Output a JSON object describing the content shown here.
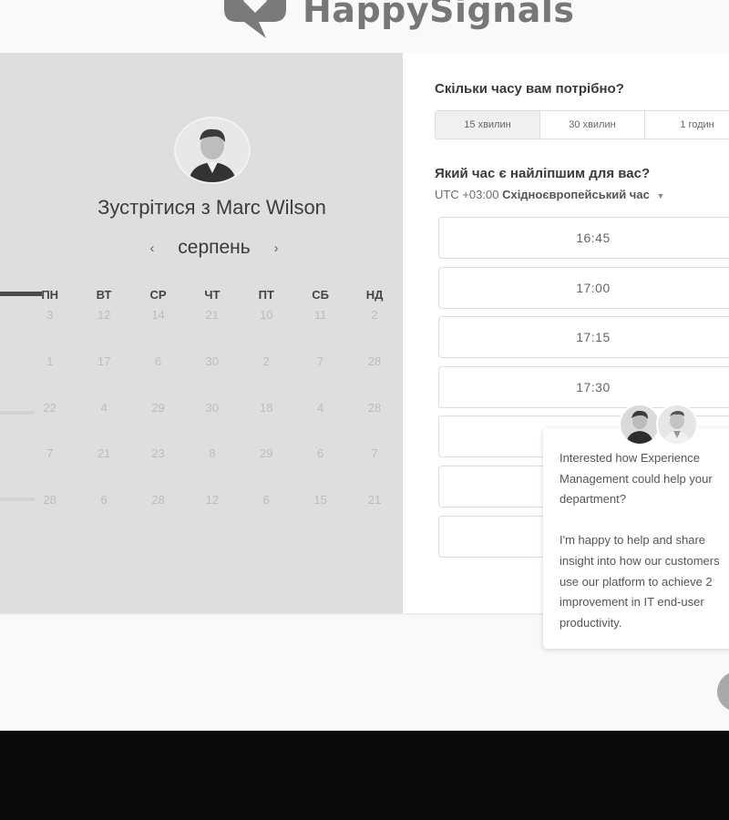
{
  "header": {
    "logo_text": "HappySignals",
    "logo_icon": "speech-heart-icon"
  },
  "left": {
    "title": "Зустрітися з Marc Wilson",
    "month": "серпень",
    "prev_icon": "‹",
    "next_icon": "›",
    "weekdays": [
      "ПН",
      "ВТ",
      "СР",
      "ЧТ",
      "ПТ",
      "СБ",
      "НД"
    ],
    "days": [
      [
        "3",
        "12",
        "14",
        "21",
        "10",
        "11",
        "2"
      ],
      [
        "1",
        "17",
        "6",
        "30",
        "2",
        "7",
        "28"
      ],
      [
        "22",
        "4",
        "29",
        "30",
        "18",
        "4",
        "28"
      ],
      [
        "7",
        "21",
        "23",
        "8",
        "29",
        "6",
        "7"
      ],
      [
        "28",
        "6",
        "28",
        "12",
        "6",
        "15",
        "21"
      ]
    ]
  },
  "right": {
    "duration_question": "Скільки часу вам потрібно?",
    "durations": [
      "15 хвилин",
      "30 хвилин",
      "1 годин"
    ],
    "selected_duration": "15 хвилин",
    "time_question": "Який час є найліпшим для вас?",
    "timezone_offset": "UTC +03:00",
    "timezone_name": "Східноєвропейський час",
    "slots": [
      "16:45",
      "17:00",
      "17:15",
      "17:30",
      "",
      "",
      ""
    ]
  },
  "chat": {
    "message": "Interested how Experience\nManagement could help your\ndepartment?\n\nI'm happy to help and share\ninsight into how our customers\nuse our platform to achieve 2\nimprovement in IT end-user\nproductivity."
  },
  "colors": {
    "page_bg": "#f9f9f9",
    "left_panel": "#dedede",
    "right_panel": "#ffffff",
    "bottom_bar": "#0a0a0a"
  }
}
